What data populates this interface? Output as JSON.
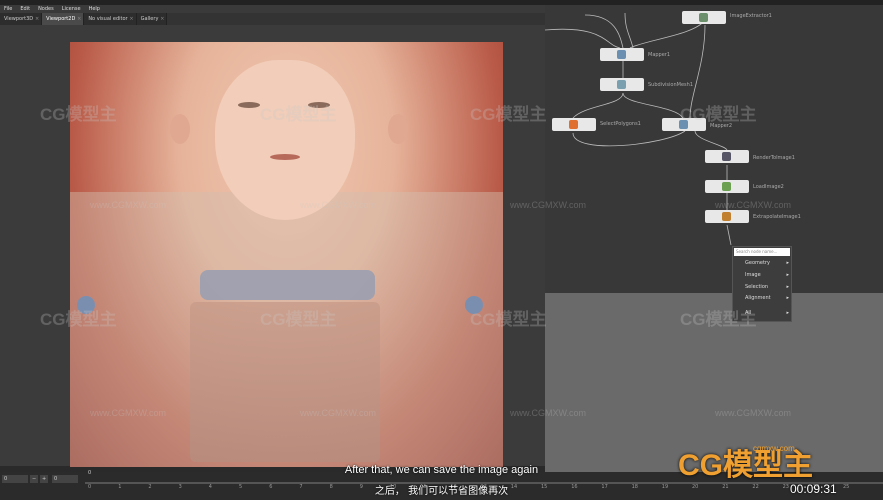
{
  "menu": [
    "File",
    "Edit",
    "Nodes",
    "License",
    "Help"
  ],
  "tabs": [
    {
      "label": "Viewport3D",
      "active": false
    },
    {
      "label": "Viewport2D",
      "active": true
    },
    {
      "label": "No visual editor",
      "active": false
    },
    {
      "label": "Gallery",
      "active": false
    }
  ],
  "nodes": [
    {
      "label": "ImageExtractor1",
      "icon_color": "#6b8f6b"
    },
    {
      "label": "Mapper1",
      "icon_color": "#6b8fb0"
    },
    {
      "label": "SubdivisionMesh1",
      "icon_color": "#7aa0b0"
    },
    {
      "label": "SelectPolygons1",
      "icon_color": "#e07030"
    },
    {
      "label": "Mapper2",
      "icon_color": "#6b8fb0"
    },
    {
      "label": "RenderToImage1",
      "icon_color": "#556"
    },
    {
      "label": "LoadImage2",
      "icon_color": "#6aa050"
    },
    {
      "label": "ExtrapolateImage1",
      "icon_color": "#c08030"
    }
  ],
  "context_menu": {
    "search_placeholder": "Search node name...",
    "items": [
      "Geometry",
      "Image",
      "Selection",
      "Alignment",
      "All"
    ]
  },
  "subtitles": {
    "english": "After that, we can save the image again",
    "chinese": "之后， 我们可以节省图像再次"
  },
  "timeline": {
    "start_value": "0",
    "end_value": "0",
    "current_frame": "0",
    "ticks": [
      "0",
      "1",
      "2",
      "3",
      "4",
      "5",
      "6",
      "7",
      "8",
      "9",
      "10",
      "11",
      "12",
      "13",
      "14",
      "15",
      "16",
      "17",
      "18",
      "19",
      "20",
      "21",
      "22",
      "23",
      "24",
      "25"
    ]
  },
  "watermark": {
    "text": "CG模型主",
    "url": "www.CGMXW.com"
  },
  "logo": {
    "text": "CG模型主",
    "url": "cgmxw.com"
  },
  "timestamp": "00:09:31",
  "colors": {
    "accent": "#f0a030",
    "node_bg": "#e8e8e8",
    "panel_bg": "#383838"
  }
}
